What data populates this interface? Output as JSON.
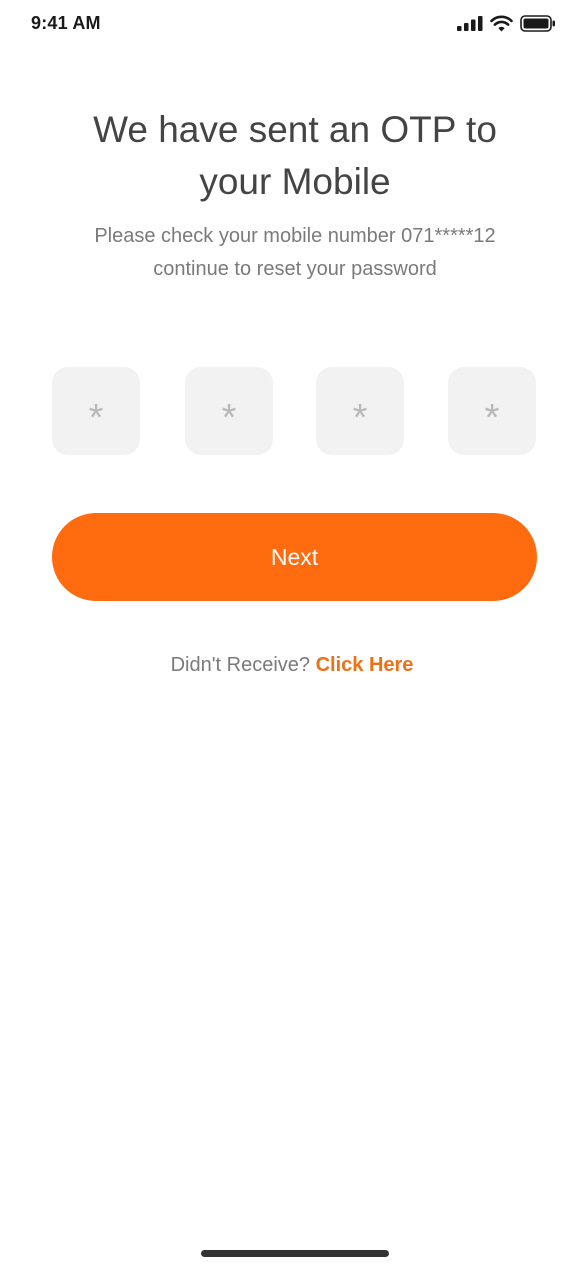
{
  "status_bar": {
    "time": "9:41 AM",
    "icons": [
      "signal-icon",
      "wifi-icon",
      "battery-icon"
    ]
  },
  "header": {
    "title_line1": "We have sent an OTP to",
    "title_line2": "your Mobile",
    "subtitle_line1": "Please check your mobile number 071*****12",
    "subtitle_line2": "continue to reset your password"
  },
  "otp": {
    "digits": [
      "*",
      "*",
      "*",
      "*"
    ]
  },
  "actions": {
    "next_label": "Next"
  },
  "resend": {
    "prompt": "Didn't Receive?",
    "link_label": "Click Here"
  },
  "colors": {
    "accent": "#ff6b0e",
    "link": "#f07018",
    "title_text": "#444444",
    "muted_text": "#7a7a7a",
    "otp_box_bg": "#f2f2f2"
  }
}
